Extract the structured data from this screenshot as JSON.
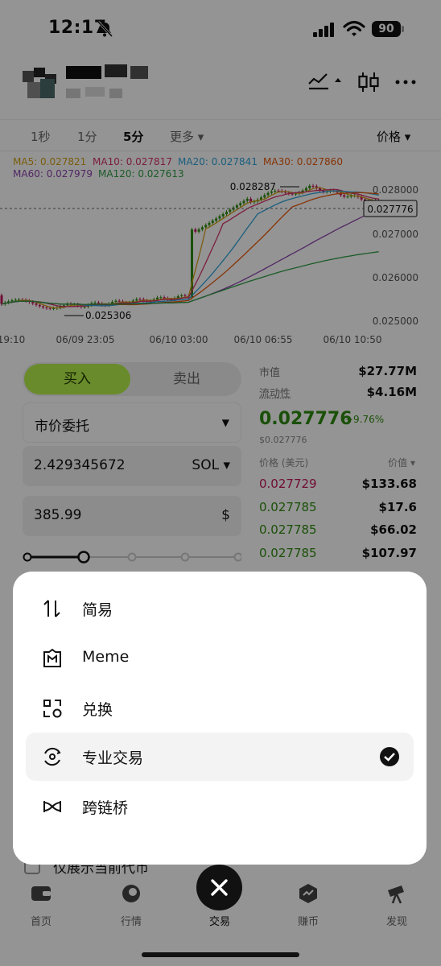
{
  "status": {
    "time": "12:17",
    "battery": "90"
  },
  "timeframes": {
    "t1": "1秒",
    "t2": "1分",
    "t3": "5分",
    "more": "更多",
    "price_label": "价格"
  },
  "chart_data": {
    "type": "candlestick",
    "ma_legend": [
      {
        "label": "MA5: 0.027821",
        "color": "#d4a017"
      },
      {
        "label": "MA10: 0.027817",
        "color": "#d6336c"
      },
      {
        "label": "MA20: 0.027841",
        "color": "#2ea3d8"
      },
      {
        "label": "MA30: 0.027860",
        "color": "#e8590c"
      },
      {
        "label": "MA60: 0.027979",
        "color": "#8e44ad"
      },
      {
        "label": "MA120: 0.027613",
        "color": "#2f9e44"
      }
    ],
    "y_ticks": [
      "0.028000",
      "0.027000",
      "0.026000",
      "0.025000"
    ],
    "x_ticks": [
      "19:10",
      "06/09 23:05",
      "06/10 03:00",
      "06/10 06:55",
      "06/10 10:50"
    ],
    "high_label": "0.028287",
    "low_label": "0.025306",
    "current_price": "0.027776",
    "ylim": [
      0.0249,
      0.0283
    ]
  },
  "trade": {
    "buy": "买入",
    "sell": "卖出",
    "order_type": "市价委托",
    "amount": "2.429345672",
    "amount_unit": "SOL",
    "usd_value": "385.99",
    "usd_unit": "$"
  },
  "market": {
    "mcap_label": "市值",
    "mcap_value": "$27.77M",
    "liq_label": "流动性",
    "liq_value": "$4.16M",
    "price": "0.027776",
    "change": "+9.76%",
    "price_usd": "$0.027776",
    "ob_price_header": "价格 (美元)",
    "ob_value_header": "价值",
    "orders": [
      {
        "price": "0.027729",
        "value": "$133.68",
        "color": "#c2185b"
      },
      {
        "price": "0.027785",
        "value": "$17.6",
        "color": "#2e8b0e"
      },
      {
        "price": "0.027785",
        "value": "$66.02",
        "color": "#2e8b0e"
      },
      {
        "price": "0.027785",
        "value": "$107.97",
        "color": "#2e8b0e"
      }
    ]
  },
  "bottom": {
    "checkbox_label": "仅展示当前代币",
    "nav": {
      "home": "首页",
      "market": "行情",
      "trade": "交易",
      "earn": "赚币",
      "discover": "发现"
    }
  },
  "menu": {
    "items": [
      {
        "label": "简易",
        "icon": "swap-arrows-icon"
      },
      {
        "label": "Meme",
        "icon": "meme-icon"
      },
      {
        "label": "兑换",
        "icon": "convert-icon"
      },
      {
        "label": "专业交易",
        "icon": "pro-trade-icon",
        "selected": true
      },
      {
        "label": "跨链桥",
        "icon": "bridge-icon"
      }
    ]
  }
}
